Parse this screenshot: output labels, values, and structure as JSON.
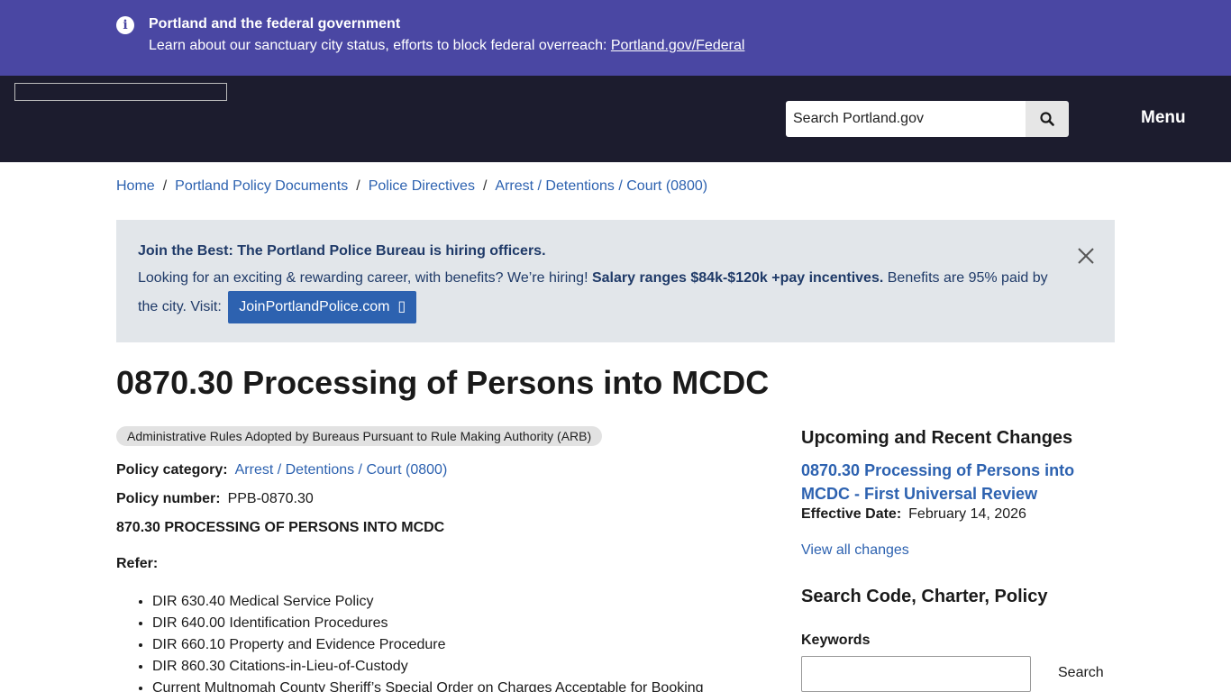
{
  "alert": {
    "title": "Portland and the federal government",
    "text": "Learn about our sanctuary city status, efforts to block federal overreach: ",
    "link": "Portland.gov/Federal",
    "icon": "info-icon"
  },
  "header": {
    "search_placeholder": "Search Portland.gov",
    "menu_label": "Menu",
    "colors": {
      "background": "#1c1c2e",
      "alert": "#4a47a3"
    }
  },
  "breadcrumb": [
    "Home",
    "Portland Policy Documents",
    "Police Directives",
    "Arrest / Detentions / Court (0800)"
  ],
  "hiring": {
    "title": "Join the Best: The Portland Police Bureau is hiring officers.",
    "text_a": "Looking for an exciting & rewarding career, with benefits? We’re hiring! ",
    "text_bold": "Salary ranges $84k-$120k +pay incentives.",
    "text_b": " Benefits are 95% paid by the city. Visit: ",
    "button": "JoinPortlandPolice.com",
    "button_icon_glyph": "▯"
  },
  "page": {
    "title": "0870.30 Processing of Persons into MCDC",
    "tag": "Administrative Rules Adopted by Bureaus Pursuant to Rule Making Authority (ARB)",
    "category_label": "Policy category:",
    "category_value": "Arrest / Detentions / Court (0800)",
    "number_label": "Policy number:",
    "number_value": "PPB-0870.30",
    "doc_heading": "870.30 PROCESSING OF PERSONS INTO MCDC",
    "refer_label": "Refer:",
    "refer_items": [
      "DIR 630.40 Medical Service Policy",
      "DIR 640.00 Identification Procedures",
      "DIR 660.10 Property and Evidence Procedure",
      "DIR 860.30 Citations-in-Lieu-of-Custody",
      "Current Multnomah County Sheriff’s Special Order on Charges Acceptable for Booking"
    ]
  },
  "sidebar": {
    "changes_heading": "Upcoming and Recent Changes",
    "change_link": "0870.30 Processing of Persons into MCDC - First Universal Review",
    "effective_label": "Effective Date:",
    "effective_value": "February 14, 2026",
    "view_all": "View all changes",
    "search_heading": "Search Code, Charter, Policy",
    "keywords_label": "Keywords",
    "search_button": "Search"
  }
}
